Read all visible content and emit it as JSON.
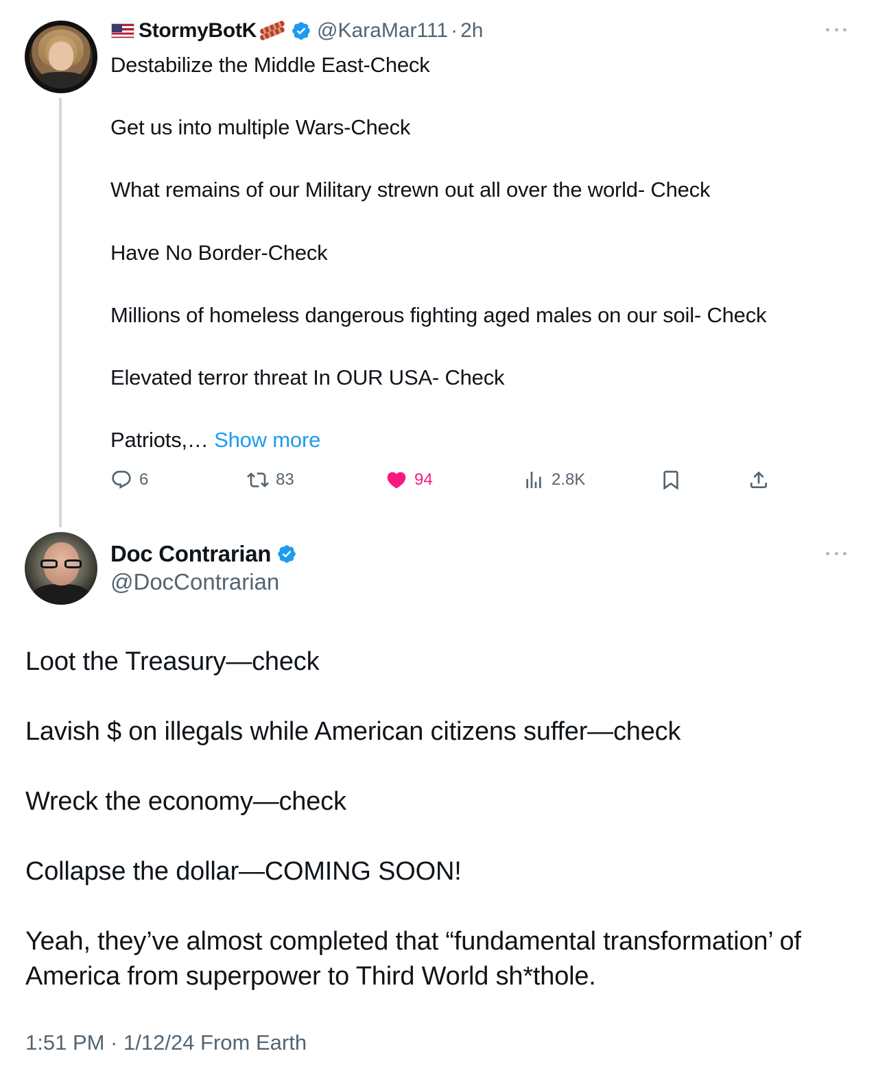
{
  "parent_tweet": {
    "display_name": "StormyBotK",
    "handle": "@KaraMar111",
    "separator": "·",
    "time_ago": "2h",
    "text": "Destabilize the Middle East-Check\n\nGet us into multiple Wars-Check\n\nWhat remains of our Military strewn out all over the world- Check\n\nHave No Border-Check\n\nMillions of homeless dangerous fighting aged males on our soil- Check\n\nElevated terror threat In OUR USA- Check\n\nPatriots,… ",
    "show_more_label": "Show more",
    "actions": {
      "replies": "6",
      "retweets": "83",
      "likes": "94",
      "views": "2.8K"
    },
    "colors": {
      "like": "#f91880",
      "verified": "#1d9bf0",
      "link": "#1d9bf0"
    }
  },
  "main_tweet": {
    "display_name": "Doc Contrarian",
    "handle": "@DocContrarian",
    "text": "Loot the Treasury—check\n\nLavish $ on illegals while American citizens suffer—check\n\nWreck the economy—check\n\nCollapse the dollar—COMING SOON!\n\nYeah, they’ve almost completed that “fundamental transformation’ of America from superpower to Third World sh*thole.",
    "timestamp": "1:51 PM · 1/12/24 From Earth"
  }
}
